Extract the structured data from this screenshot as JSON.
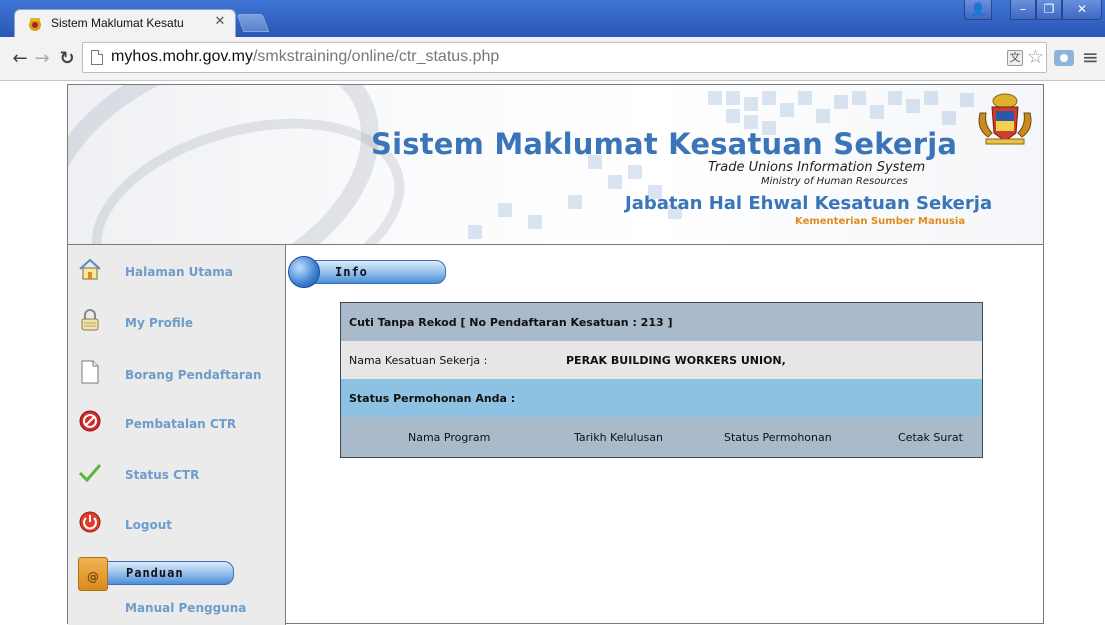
{
  "browser": {
    "tab_title": "Sistem Maklumat Kesatu",
    "url_host": "myhos.mohr.gov.my",
    "url_path": "/smkstraining/online/ctr_status.php"
  },
  "banner": {
    "title": "Sistem Maklumat Kesatuan Sekerja",
    "subtitle_line1": "Trade Unions Information System",
    "subtitle_line2": "Ministry of Human Resources",
    "department": "Jabatan Hal Ehwal Kesatuan Sekerja",
    "ministry": "Kementerian Sumber Manusia"
  },
  "sidebar": {
    "items": [
      {
        "label": "Halaman Utama",
        "icon": "home-icon"
      },
      {
        "label": "My Profile",
        "icon": "lock-icon"
      },
      {
        "label": "Borang Pendaftaran",
        "icon": "document-icon"
      },
      {
        "label": "Pembatalan CTR",
        "icon": "cancel-icon"
      },
      {
        "label": "Status CTR",
        "icon": "checkmark-icon"
      },
      {
        "label": "Logout",
        "icon": "power-icon"
      }
    ],
    "panduan_label": "Panduan",
    "manual_label": "Manual Pengguna"
  },
  "content": {
    "info_label": "Info",
    "table": {
      "title": "Cuti Tanpa Rekod [ No Pendaftaran Kesatuan : 213 ]",
      "union_label": "Nama Kesatuan Sekerja :",
      "union_value": "PERAK BUILDING WORKERS UNION,",
      "status_heading": "Status Permohonan Anda :",
      "columns": [
        "Nama Program",
        "Tarikh Kelulusan",
        "Status Permohonan",
        "Cetak Surat"
      ]
    }
  },
  "colors": {
    "accent_blue": "#3a74b9",
    "sidebar_text": "#6e9ccb",
    "ministry_orange": "#e08a1e"
  }
}
